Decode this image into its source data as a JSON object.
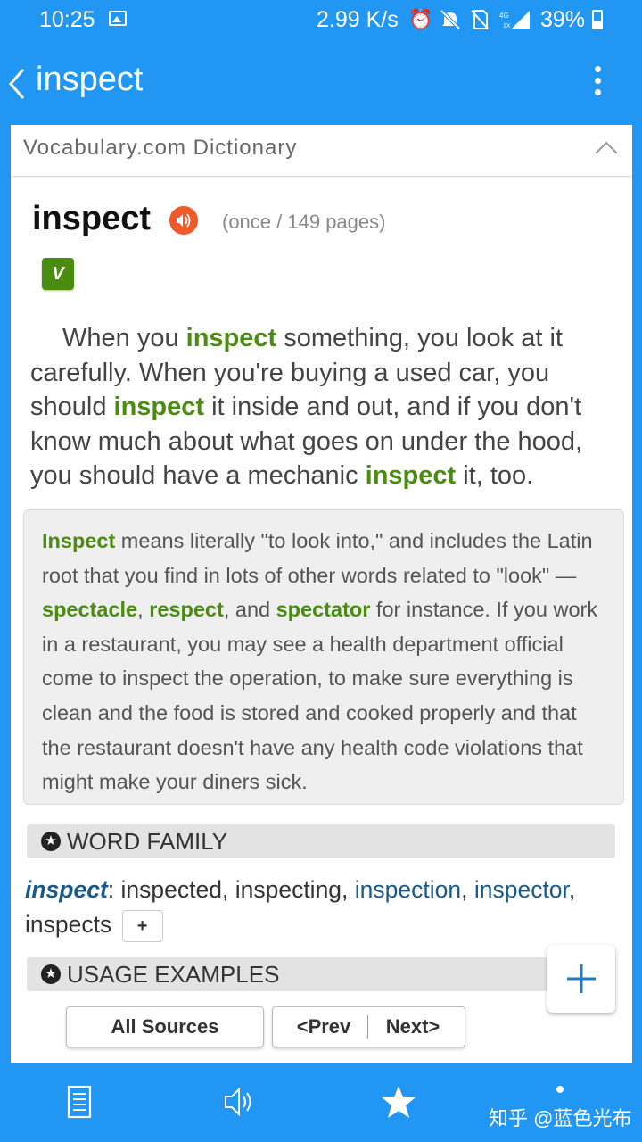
{
  "status_bar": {
    "time": "10:25",
    "network_speed": "2.99 K/s",
    "battery": "39%",
    "icons": [
      "image-icon",
      "alarm-icon",
      "mute-icon",
      "no-sim-icon",
      "signal-icon",
      "battery-icon"
    ]
  },
  "app_bar": {
    "title": "inspect",
    "back_icon": "back-icon",
    "menu_icon": "more-vert-icon"
  },
  "dictionary": {
    "header": "Vocabulary.com Dictionary",
    "word": "inspect",
    "frequency": "(once / 149 pages)",
    "part_of_speech": "V",
    "short_definition": [
      {
        "t": "When you ",
        "h": false
      },
      {
        "t": "inspect",
        "h": true
      },
      {
        "t": " something, you look at it carefully. When you're buying a used car, you should ",
        "h": false
      },
      {
        "t": "inspect",
        "h": true
      },
      {
        "t": " it inside and out, and if you don't know much about what goes on under the hood, you should have a mechanic ",
        "h": false
      },
      {
        "t": "inspect",
        "h": true
      },
      {
        "t": " it, too.",
        "h": false
      }
    ],
    "long_definition": [
      {
        "t": "Inspect",
        "h": true
      },
      {
        "t": " means literally \"to look into,\" and includes the Latin root that you find in lots of other words related to \"look\" — ",
        "h": false
      },
      {
        "t": "spectacle",
        "h": true
      },
      {
        "t": ", ",
        "h": false
      },
      {
        "t": "respect",
        "h": true
      },
      {
        "t": ", and ",
        "h": false
      },
      {
        "t": "spectator",
        "h": true
      },
      {
        "t": " for instance. If you work in a restaurant, you may see a health department official come to inspect the operation, to make sure everything is clean and the food is stored and cooked properly and that the restaurant doesn't have any health code violations that might make your diners sick.",
        "h": false
      }
    ]
  },
  "word_family": {
    "title": "WORD FAMILY",
    "head": "inspect",
    "separator": ":",
    "forms": [
      {
        "t": "inspected",
        "link": false
      },
      {
        "t": "inspecting",
        "link": false
      },
      {
        "t": "inspection",
        "link": true
      },
      {
        "t": "inspector",
        "link": true
      },
      {
        "t": "inspects",
        "link": false
      }
    ],
    "more_label": "+"
  },
  "usage_examples": {
    "title": "USAGE EXAMPLES",
    "all_sources": "All Sources",
    "prev": "<Prev",
    "next": "Next>"
  },
  "fab_icon": "plus-icon",
  "bottom_nav": {
    "items": [
      "definition-icon",
      "speaker-icon",
      "star-icon",
      "more-icon"
    ]
  },
  "watermark": "知乎 @蓝色光布",
  "colors": {
    "primary": "#2196f3",
    "highlight": "#4a8c10",
    "link": "#1a5a8a",
    "speaker": "#f05a28"
  }
}
